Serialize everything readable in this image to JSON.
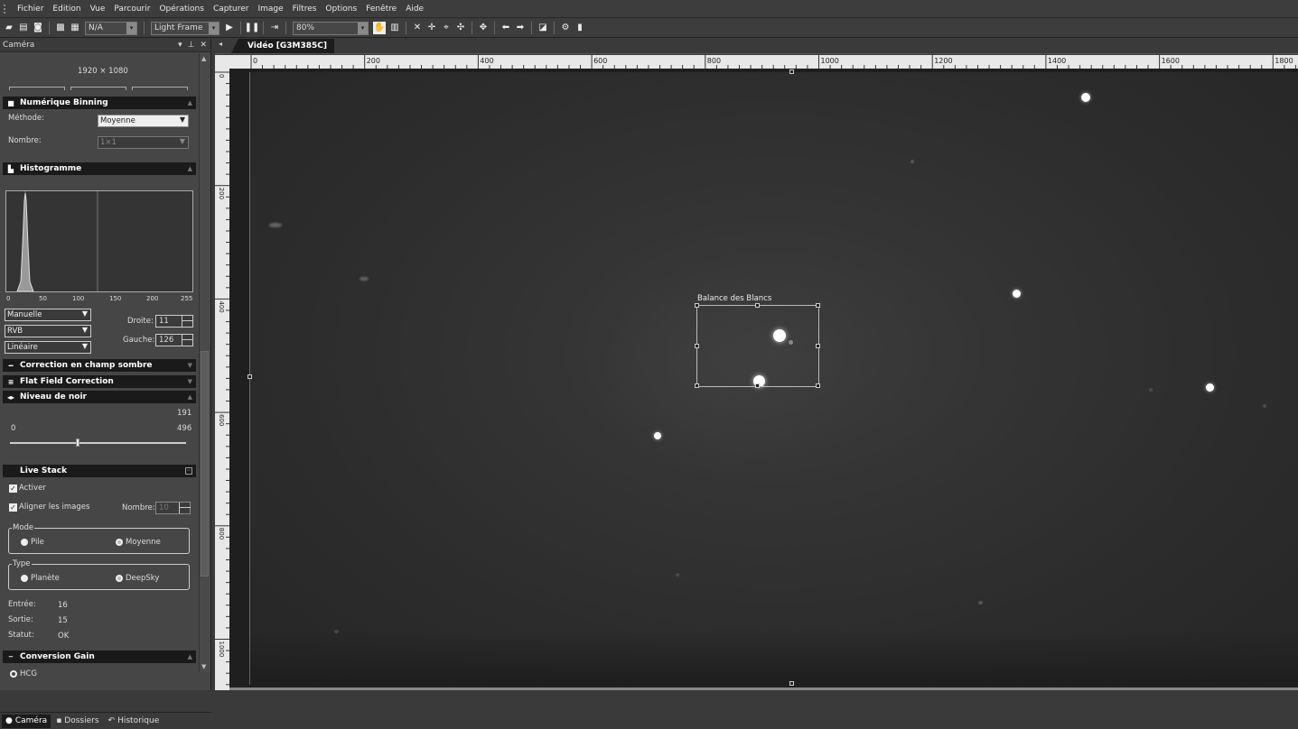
{
  "menu": [
    "Fichier",
    "Edition",
    "Vue",
    "Parcourir",
    "Opérations",
    "Capturer",
    "Image",
    "Filtres",
    "Options",
    "Fenêtre",
    "Aide"
  ],
  "toolbar": {
    "combo1": "N/A",
    "combo2": "Light Frame",
    "zoom": "80%"
  },
  "panel": {
    "title": "Caméra",
    "resolution": "1920 × 1080",
    "binning": {
      "header": "Numérique Binning",
      "methode_label": "Méthode:",
      "methode_value": "Moyenne",
      "nombre_label": "Nombre:",
      "nombre_value": "1×1"
    },
    "histogram": {
      "header": "Histogramme",
      "ticks": [
        "0",
        "50",
        "100",
        "150",
        "200",
        "255"
      ],
      "mode1": "Manuelle",
      "mode2": "RVB",
      "mode3": "Linéaire",
      "droite_label": "Droite:",
      "droite_value": "11",
      "gauche_label": "Gauche:",
      "gauche_value": "126"
    },
    "dark": {
      "header": "Correction en champ sombre"
    },
    "flat": {
      "header": "Flat Field Correction"
    },
    "black": {
      "header": "Niveau de noir",
      "value": "191",
      "min": "0",
      "max": "496",
      "level": 0.385
    },
    "livestack": {
      "header": "Live Stack",
      "activer": "Activer",
      "aligner": "Aligner les images",
      "nombre_label": "Nombre:",
      "nombre_value": "10",
      "mode_title": "Mode",
      "mode_pile": "Pile",
      "mode_moyenne": "Moyenne",
      "type_title": "Type",
      "type_planete": "Planète",
      "type_deepsky": "DeepSky",
      "entree_label": "Entrée:",
      "entree_value": "16",
      "sortie_label": "Sortie:",
      "sortie_value": "15",
      "statut_label": "Statut:",
      "statut_value": "OK"
    },
    "gain": {
      "header": "Conversion Gain",
      "hcg": "HCG"
    }
  },
  "bottom_tabs": [
    "Caméra",
    "Dossiers",
    "Historique"
  ],
  "document": {
    "tab": "Vidéo [G3M385C]",
    "hticks": [
      "0",
      "200",
      "400",
      "600",
      "800",
      "1000",
      "1200",
      "1400",
      "1600",
      "1800"
    ],
    "vticks": [
      "0",
      "200",
      "400",
      "600",
      "800",
      "1000"
    ],
    "wb_label": "Balance des Blancs"
  }
}
